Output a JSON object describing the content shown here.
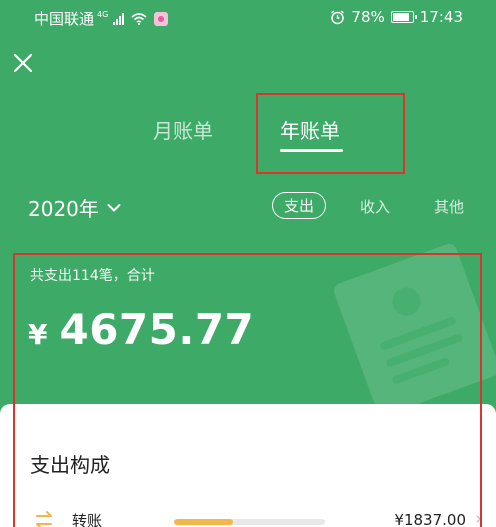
{
  "status_bar": {
    "carrier": "中国联通",
    "network": "4G",
    "battery": "78%",
    "time": "17:43",
    "icons": [
      "signal-icon",
      "wifi-icon",
      "app-notification-icon",
      "alarm-icon",
      "battery-icon"
    ]
  },
  "header": {
    "close_icon": "close-icon",
    "tabs": [
      {
        "label": "月账单",
        "active": false
      },
      {
        "label": "年账单",
        "active": true
      }
    ]
  },
  "controls": {
    "year": "2020年",
    "filters": [
      {
        "label": "支出",
        "active": true
      },
      {
        "label": "收入",
        "active": false
      },
      {
        "label": "其他",
        "active": false
      }
    ]
  },
  "summary": {
    "line": "共支出114笔，合计",
    "currency": "¥",
    "total": "4675.77"
  },
  "breakdown": {
    "title": "支出构成",
    "rows": [
      {
        "icon": "transfer-icon",
        "name": "转账",
        "share": 0.39,
        "amount": "¥1837.00"
      }
    ]
  },
  "colors": {
    "background": "#3daa67",
    "highlight": "#d9352f",
    "bar": "#f3b64b"
  }
}
